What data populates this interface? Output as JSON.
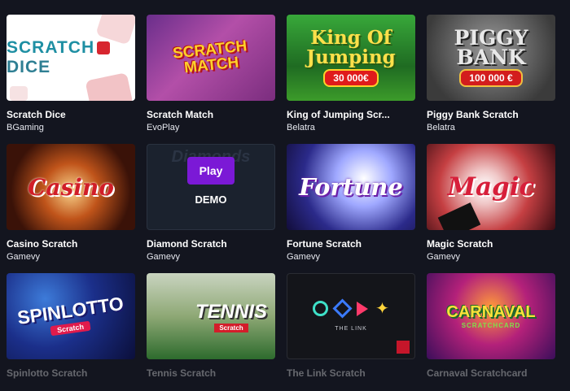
{
  "games": [
    {
      "title": "Scratch Dice",
      "provider": "BGaming",
      "thumb_text": "SCRATCH",
      "thumb_text2": "DICE"
    },
    {
      "title": "Scratch Match",
      "provider": "EvoPlay",
      "thumb_text": "SCRATCH",
      "thumb_text2": "MATCH"
    },
    {
      "title": "King of Jumping Scr...",
      "provider": "Belatra",
      "thumb_text": "King Of",
      "thumb_text2": "Jumping",
      "prize": "30 000€"
    },
    {
      "title": "Piggy Bank Scratch",
      "provider": "Belatra",
      "thumb_text": "PIGGY",
      "thumb_text2": "BANK",
      "prize": "100 000 €"
    },
    {
      "title": "Casino Scratch",
      "provider": "Gamevy",
      "thumb_text": "Casino"
    },
    {
      "title": "Diamond Scratch",
      "provider": "Gamevy",
      "thumb_text": "Diamonds",
      "play_label": "Play",
      "demo_label": "DEMO"
    },
    {
      "title": "Fortune Scratch",
      "provider": "Gamevy",
      "thumb_text": "Fortune"
    },
    {
      "title": "Magic Scratch",
      "provider": "Gamevy",
      "thumb_text": "Magic"
    },
    {
      "title": "Spinlotto Scratch",
      "provider": "",
      "thumb_text": "SPINLOTTO",
      "thumb_text2": "Scratch"
    },
    {
      "title": "Tennis Scratch",
      "provider": "",
      "thumb_text": "TENNIS",
      "thumb_text2": "Scratch"
    },
    {
      "title": "The Link Scratch",
      "provider": "",
      "thumb_text": "THE LINK"
    },
    {
      "title": "Carnaval Scratchcard",
      "provider": "",
      "thumb_text": "CARNAVAL",
      "thumb_text2": "SCRATCHCARD"
    }
  ]
}
